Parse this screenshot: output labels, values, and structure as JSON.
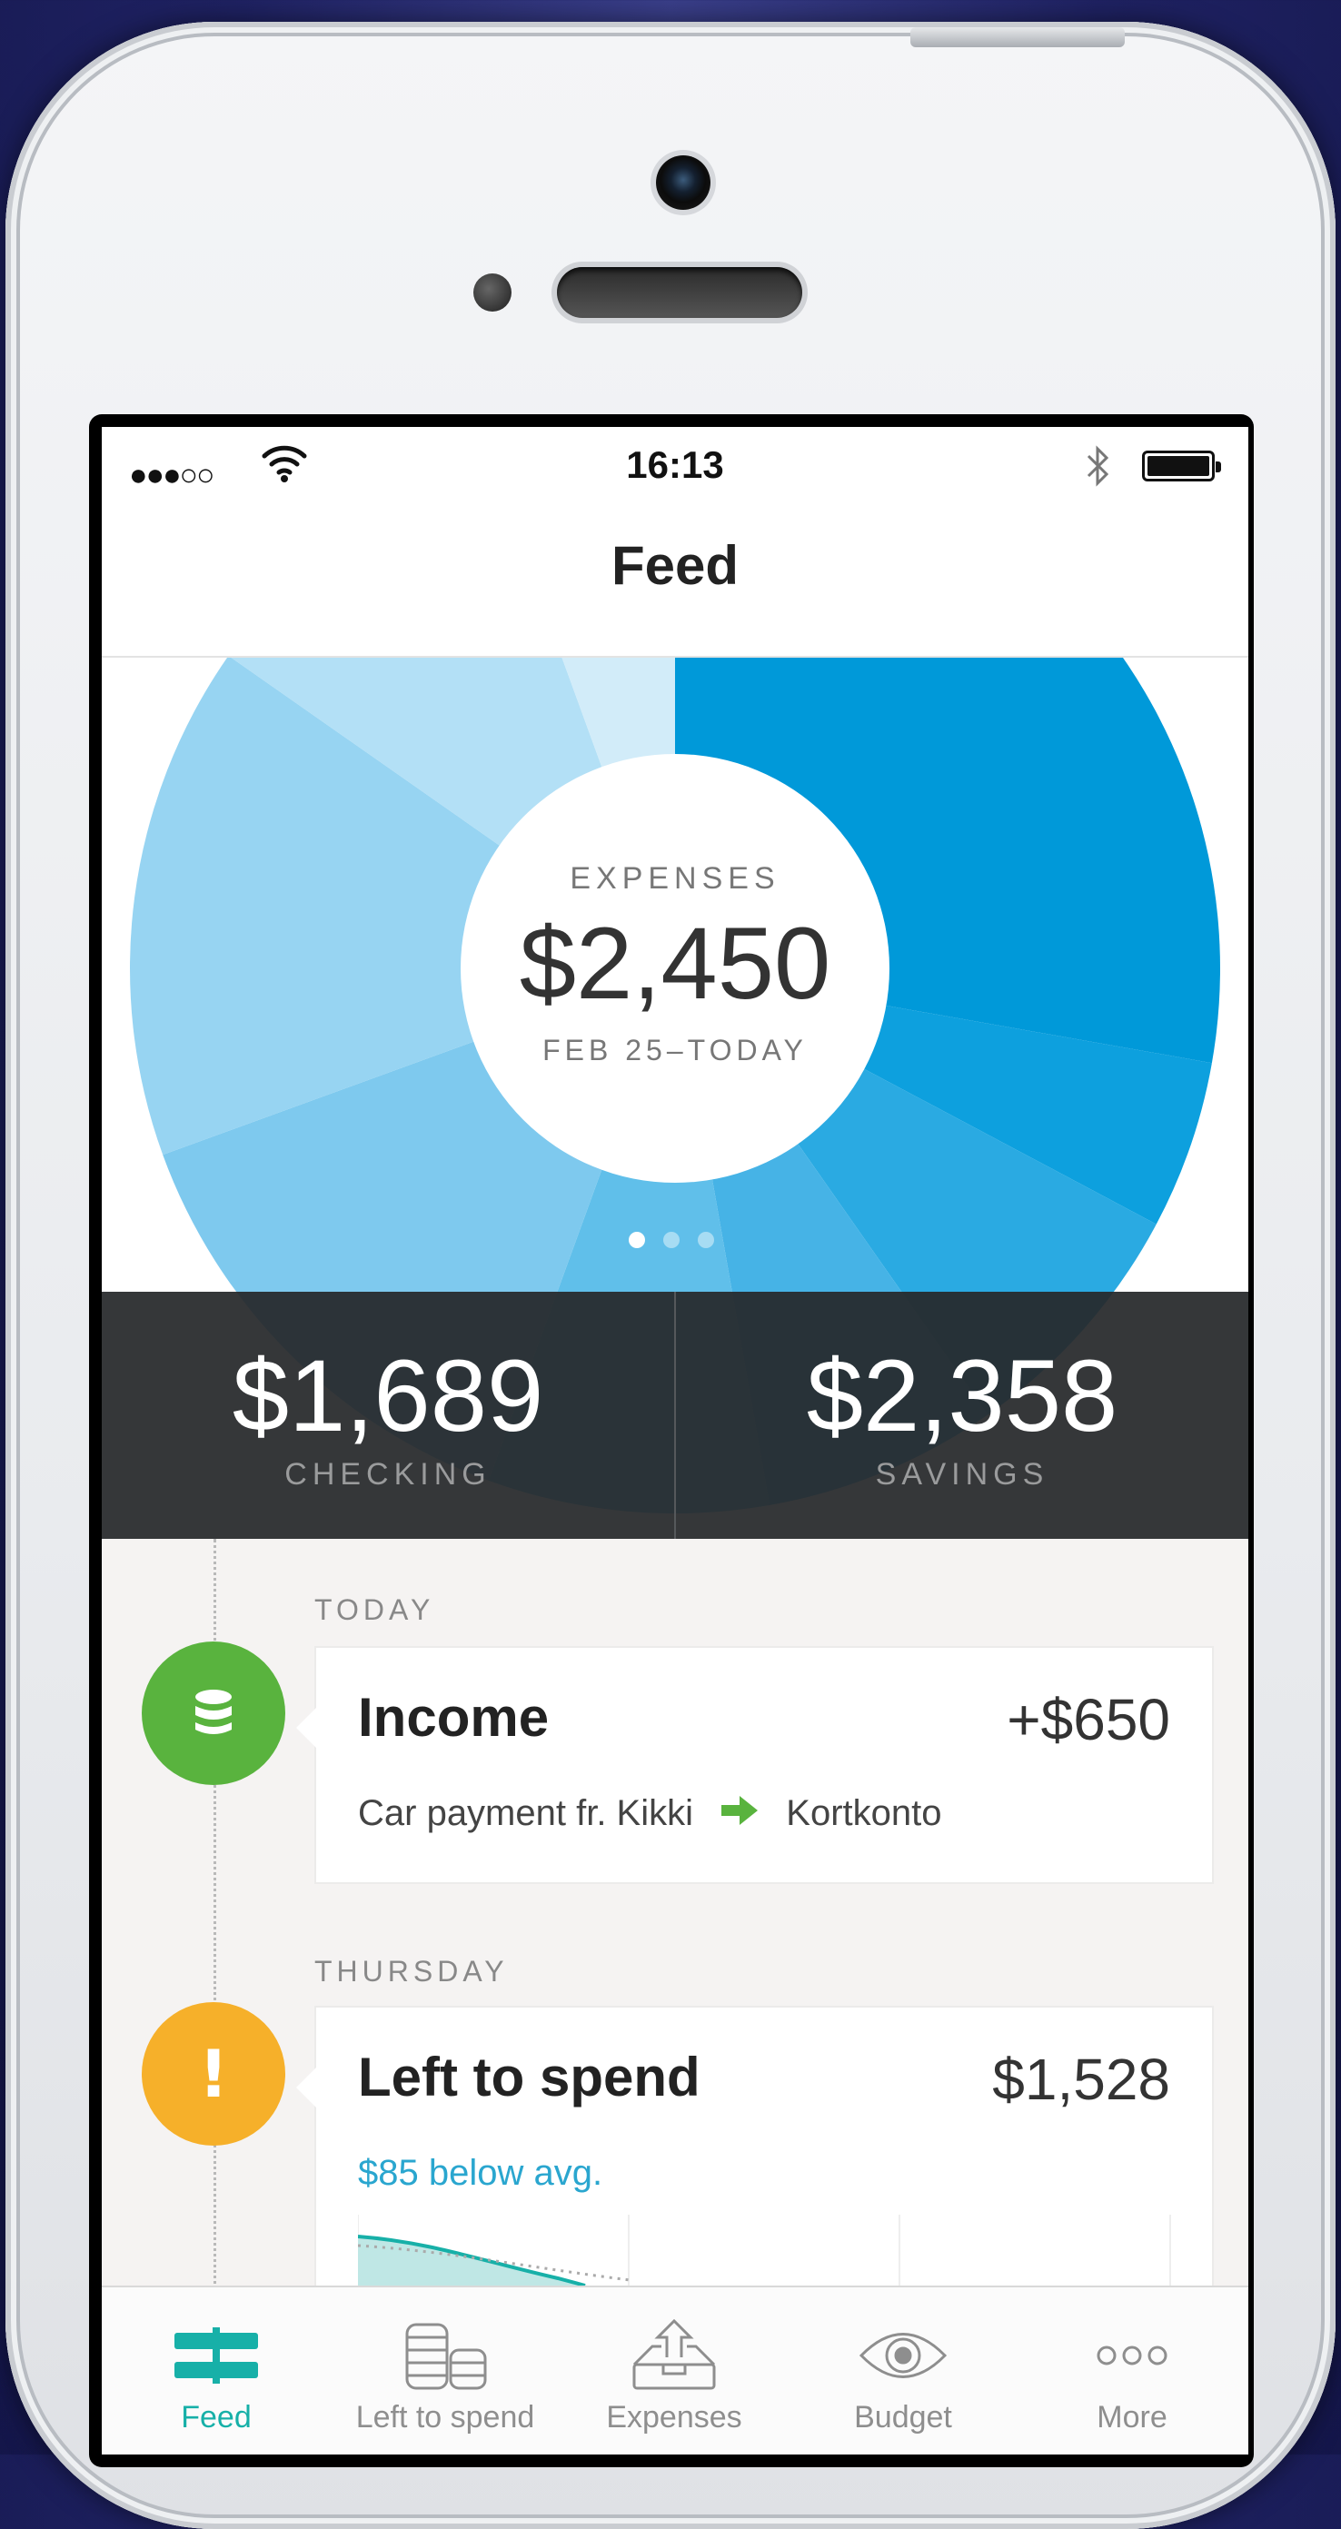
{
  "status_bar": {
    "signal": "●●●○○",
    "time": "16:13",
    "wifi_icon": "wifi-icon",
    "bluetooth_icon": "bluetooth-icon",
    "battery_icon": "battery-icon"
  },
  "nav": {
    "title": "Feed"
  },
  "expenses": {
    "label": "EXPENSES",
    "amount": "$2,450",
    "range": "FEB 25–TODAY",
    "page_count": 3,
    "active_page": 1,
    "colors": [
      "#0099d9",
      "#0da0de",
      "#2aaae2",
      "#46b3e6",
      "#60bfea",
      "#7ec9ee",
      "#97d4f2",
      "#b3e0f6",
      "#d2ecf9"
    ]
  },
  "balances": [
    {
      "amount": "$1,689",
      "label": "CHECKING"
    },
    {
      "amount": "$2,358",
      "label": "SAVINGS"
    }
  ],
  "feed": {
    "sections": [
      {
        "heading": "TODAY",
        "card": {
          "title": "Income",
          "value": "+$650",
          "from": "Car payment fr. Kikki",
          "to": "Kortkonto",
          "badge_icon": "database-icon",
          "badge_color": "#59b33e"
        }
      },
      {
        "heading": "THURSDAY",
        "card": {
          "title": "Left to spend",
          "value": "$1,528",
          "note": "$85 below avg.",
          "badge_text": "!",
          "badge_color": "#f6b02a"
        }
      }
    ]
  },
  "tabs": [
    {
      "label": "Feed",
      "icon": "feed-icon",
      "active": true
    },
    {
      "label": "Left to spend",
      "icon": "coins-icon",
      "active": false
    },
    {
      "label": "Expenses",
      "icon": "upload-tray-icon",
      "active": false
    },
    {
      "label": "Budget",
      "icon": "eye-icon",
      "active": false
    },
    {
      "label": "More",
      "icon": "more-icon",
      "active": false
    }
  ],
  "accent_color": "#17b0a8"
}
